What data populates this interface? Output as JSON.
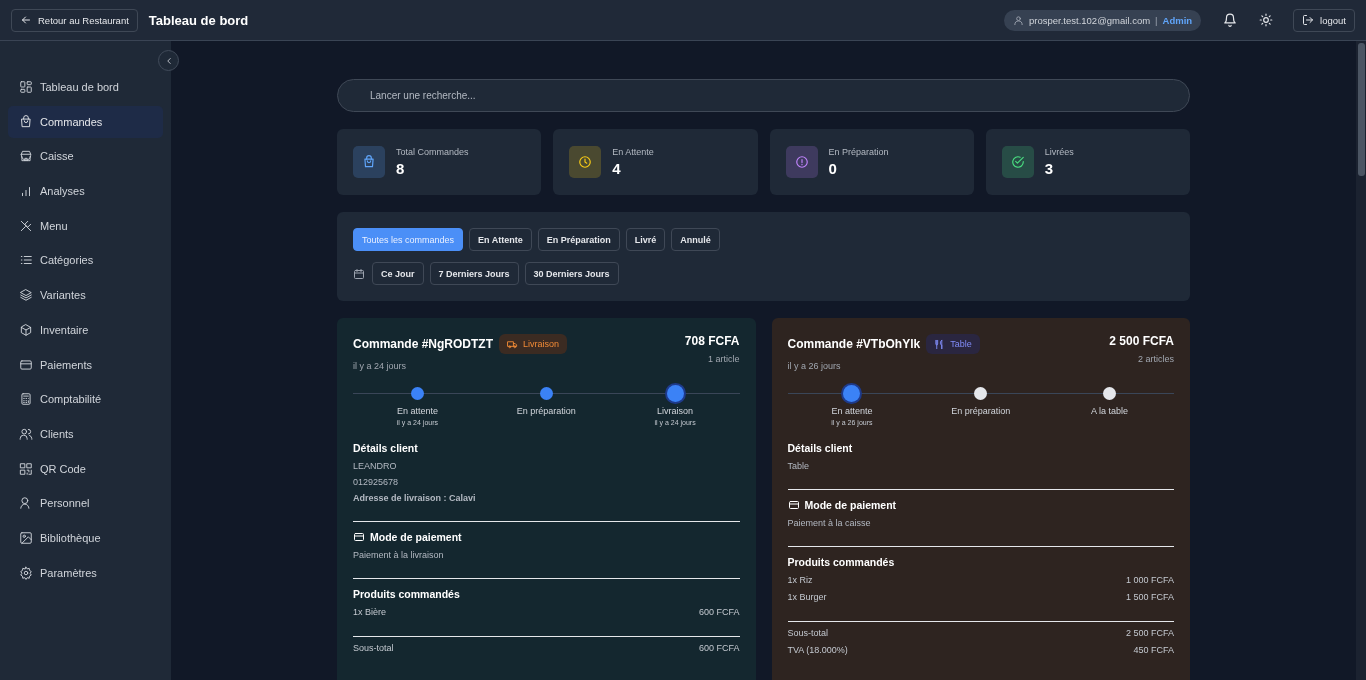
{
  "header": {
    "back_button": "Retour au Restaurant",
    "title": "Tableau de bord",
    "user_email": "prosper.test.102@gmail.com",
    "separator": "|",
    "role": "Admin",
    "logout": "logout"
  },
  "sidebar": {
    "items": [
      {
        "label": "Tableau de bord",
        "selected": false
      },
      {
        "label": "Commandes",
        "selected": true
      },
      {
        "label": "Caisse",
        "selected": false
      },
      {
        "label": "Analyses",
        "selected": false
      },
      {
        "label": "Menu",
        "selected": false
      },
      {
        "label": "Catégories",
        "selected": false
      },
      {
        "label": "Variantes",
        "selected": false
      },
      {
        "label": "Inventaire",
        "selected": false
      },
      {
        "label": "Paiements",
        "selected": false
      },
      {
        "label": "Comptabilité",
        "selected": false
      },
      {
        "label": "Clients",
        "selected": false
      },
      {
        "label": "QR Code",
        "selected": false
      },
      {
        "label": "Personnel",
        "selected": false
      },
      {
        "label": "Bibliothèque",
        "selected": false
      },
      {
        "label": "Paramètres",
        "selected": false
      }
    ]
  },
  "search": {
    "placeholder": "Lancer une recherche..."
  },
  "stats": [
    {
      "label": "Total Commandes",
      "value": "8",
      "color": "#60a5fa"
    },
    {
      "label": "En Attente",
      "value": "4",
      "color": "#facc15"
    },
    {
      "label": "En Préparation",
      "value": "0",
      "color": "#c084fc"
    },
    {
      "label": "Livrées",
      "value": "3",
      "color": "#4ade80"
    }
  ],
  "status_filters": [
    {
      "label": "Toutes les commandes",
      "selected": true
    },
    {
      "label": "En Attente",
      "selected": false
    },
    {
      "label": "En Préparation",
      "selected": false
    },
    {
      "label": "Livré",
      "selected": false
    },
    {
      "label": "Annulé",
      "selected": false
    }
  ],
  "period_filters": [
    {
      "label": "Ce Jour",
      "selected": false
    },
    {
      "label": "7 Derniers Jours",
      "selected": false
    },
    {
      "label": "30 Derniers Jours",
      "selected": false
    }
  ],
  "orders": [
    {
      "title": "Commande #NgRODTZT",
      "kind": "delivery",
      "badge": "Livraison",
      "total": "708 FCFA",
      "items_count": "1 article",
      "time": "il y a 24 jours",
      "steps": [
        {
          "label": "En attente",
          "time": "il y a 24 jours",
          "done": true,
          "current": false
        },
        {
          "label": "En préparation",
          "done": true,
          "current": false
        },
        {
          "label": "Livraison",
          "time": "il y a 24 jours",
          "done": true,
          "current": true
        }
      ],
      "client_heading": "Détails client",
      "client_lines": [
        "LEANDRO",
        "012925678"
      ],
      "address": "Adresse de livraison : Calavi",
      "payment_heading": "Mode de paiement",
      "payment": "Paiement à la livraison",
      "products_heading": "Produits commandés",
      "products": [
        {
          "name": "1x Bière",
          "price": "600 FCFA"
        }
      ],
      "totals": [
        {
          "label": "Sous-total",
          "value": "600 FCFA"
        }
      ]
    },
    {
      "title": "Commande #VTbOhYlk",
      "kind": "table",
      "badge": "Table",
      "total": "2 500 FCFA",
      "items_count": "2 articles",
      "time": "il y a 26 jours",
      "steps": [
        {
          "label": "En attente",
          "time": "il y a 26 jours",
          "done": true,
          "current": true
        },
        {
          "label": "En préparation",
          "done": false,
          "current": false
        },
        {
          "label": "A la table",
          "done": false,
          "current": false
        }
      ],
      "client_heading": "Détails client",
      "client_lines": [
        "Table"
      ],
      "payment_heading": "Mode de paiement",
      "payment": "Paiement à la caisse",
      "products_heading": "Produits commandés",
      "products": [
        {
          "name": "1x Riz",
          "price": "1 000 FCFA"
        },
        {
          "name": "1x Burger",
          "price": "1 500 FCFA"
        }
      ],
      "totals": [
        {
          "label": "Sous-total",
          "value": "2 500 FCFA"
        },
        {
          "label": "TVA (18.000%)",
          "value": "450 FCFA"
        }
      ]
    }
  ]
}
